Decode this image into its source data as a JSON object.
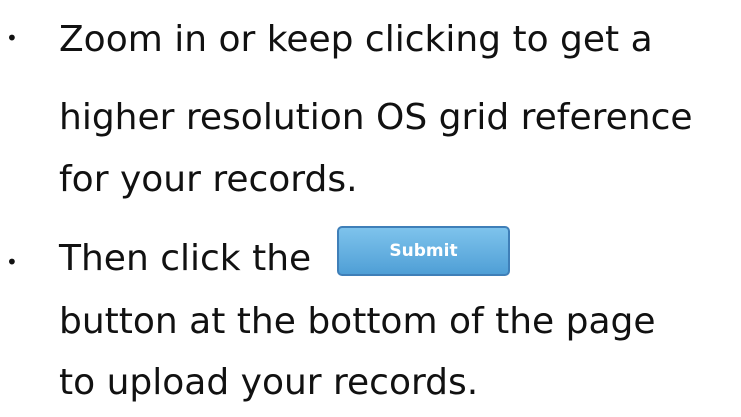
{
  "bullets": [
    {
      "lines": [
        "Zoom in or keep clicking to get a",
        "higher resolution OS grid reference",
        "for your records."
      ]
    },
    {
      "lines": [
        "Then click the",
        "button at the bottom of the page",
        "to upload your records."
      ],
      "button_label": "Submit"
    }
  ]
}
